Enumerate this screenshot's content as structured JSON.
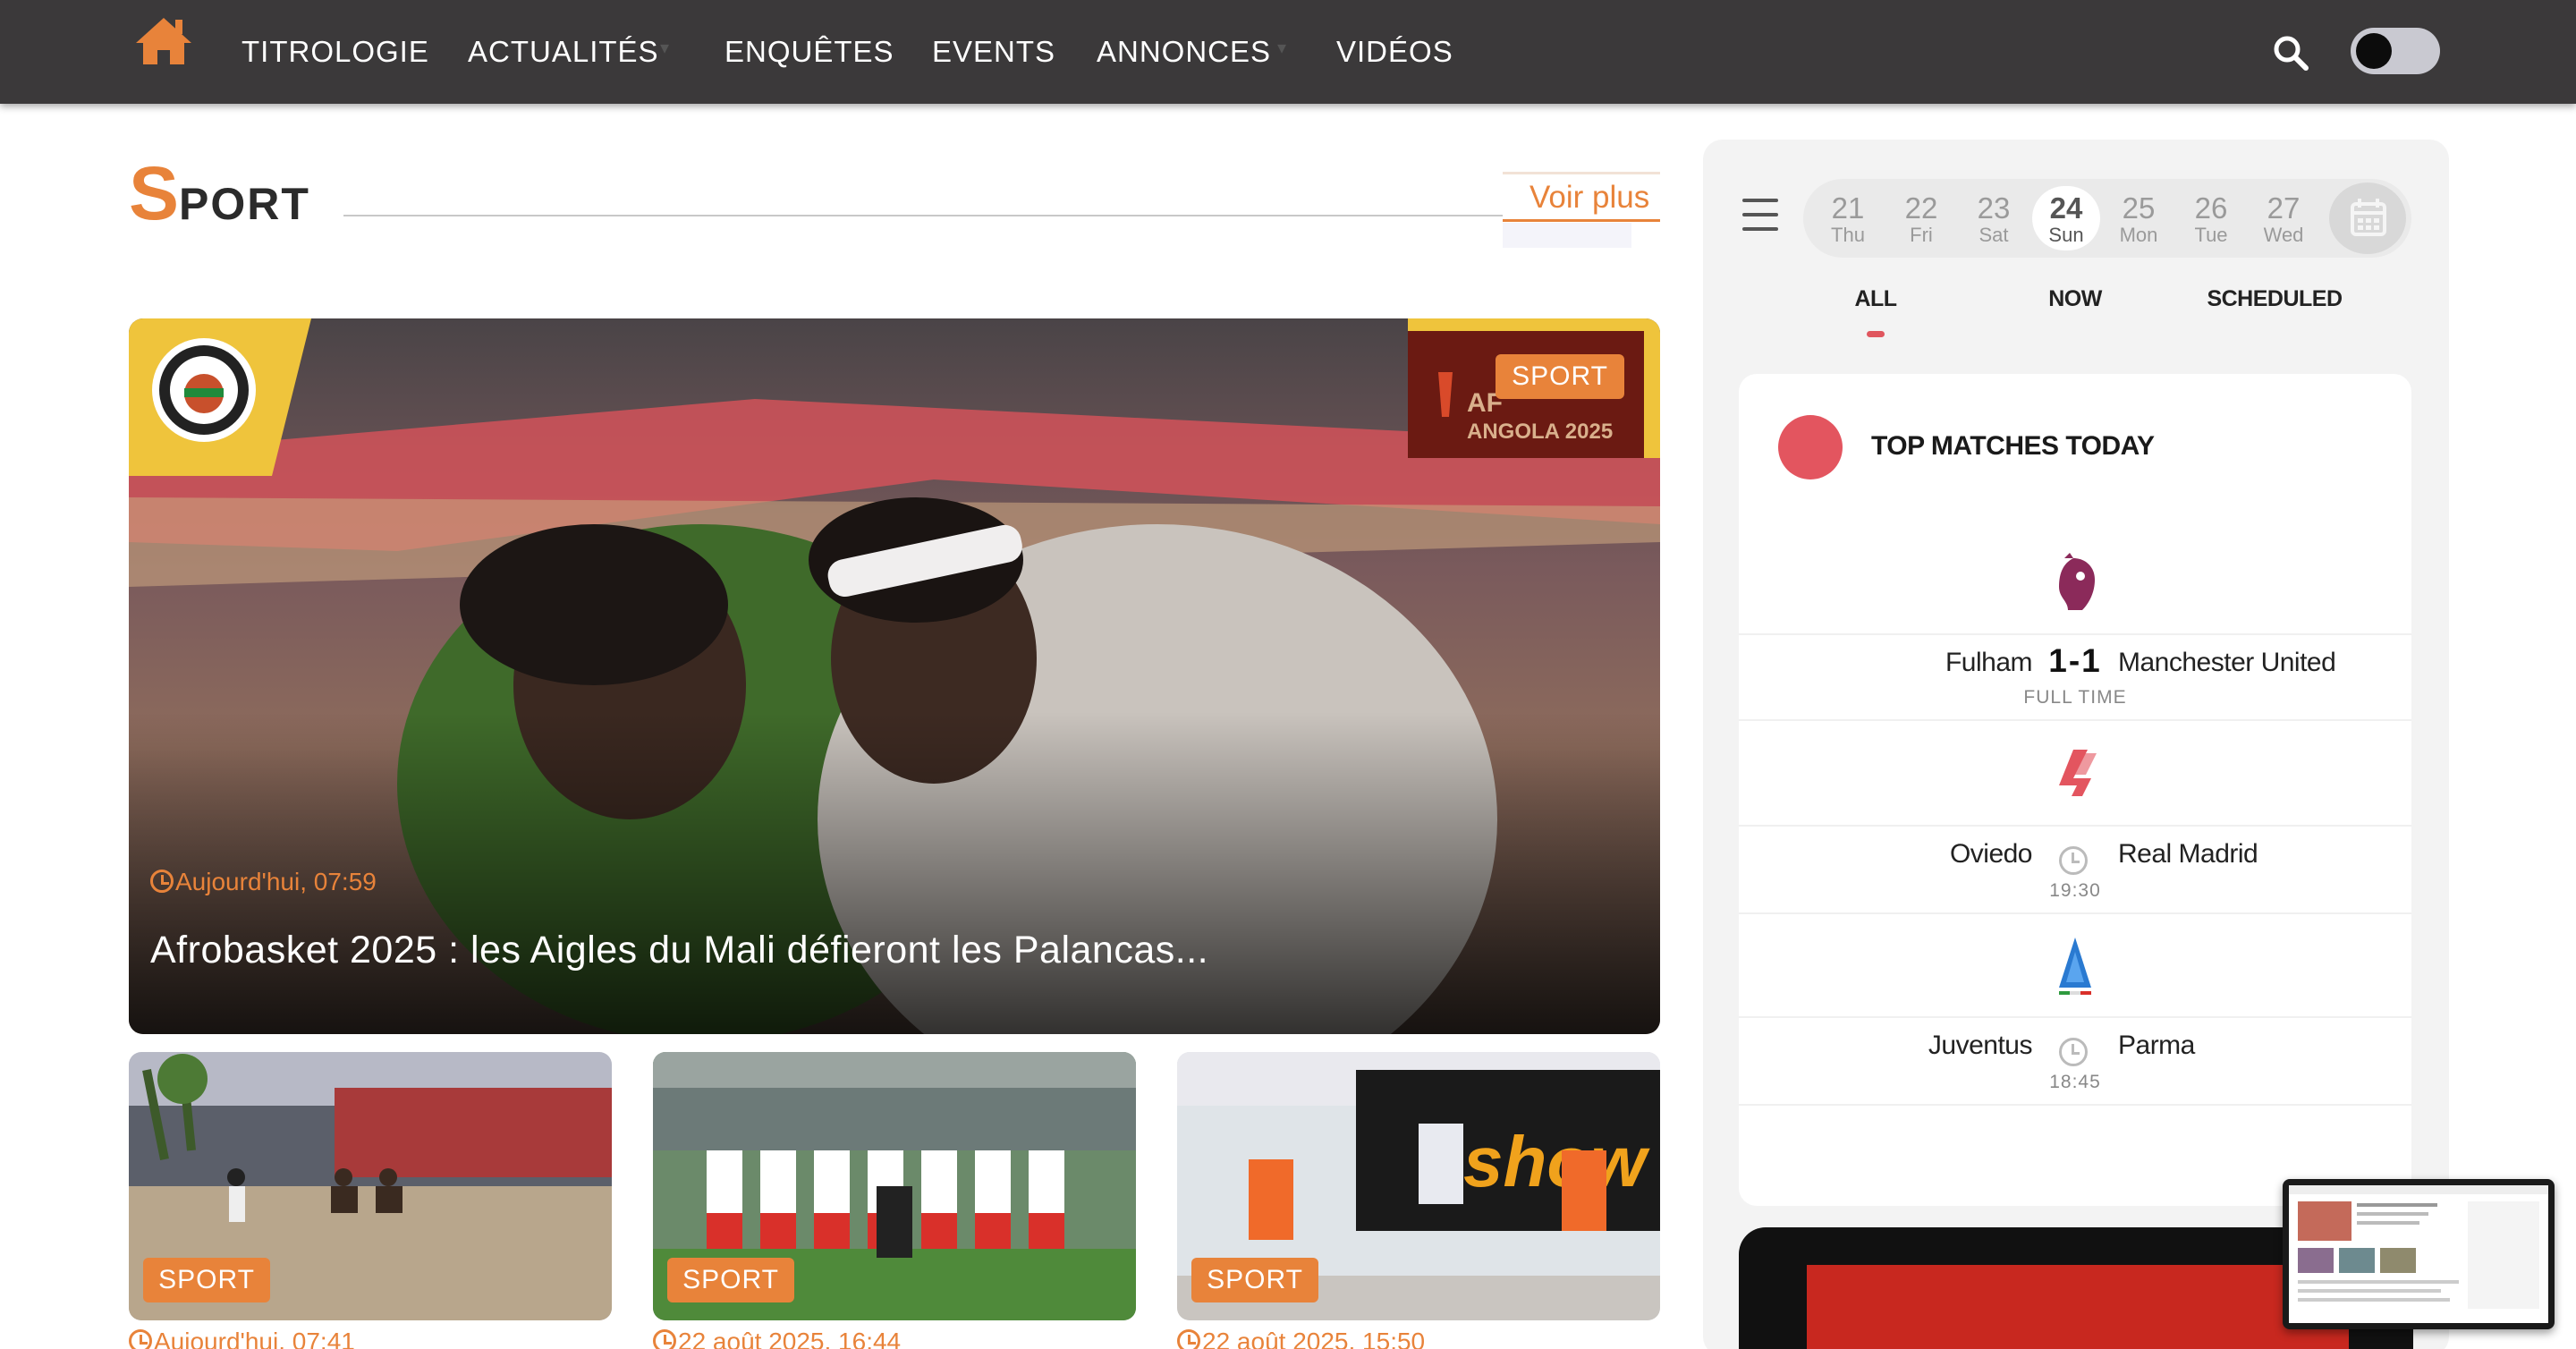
{
  "nav": {
    "items": [
      {
        "label": "TITROLOGIE"
      },
      {
        "label": "ACTUALITÉS"
      },
      {
        "label": "ENQUÊTES"
      },
      {
        "label": "EVENTS"
      },
      {
        "label": "ANNONCES"
      },
      {
        "label": "VIDÉOS"
      }
    ],
    "home_icon": "home-icon",
    "search_icon": "search-icon",
    "theme_toggle": "off"
  },
  "section": {
    "title_first": "S",
    "title_rest": "PORT",
    "voir_plus": "Voir plus"
  },
  "hero": {
    "badge": "SPORT",
    "date": "Aujourd'hui, 07:59",
    "title": "Afrobasket 2025 : les Aigles du Mali défieront les Palancas..."
  },
  "cards": [
    {
      "badge": "SPORT",
      "date": "Aujourd'hui, 07:41"
    },
    {
      "badge": "SPORT",
      "date": "22 août 2025, 16:44"
    },
    {
      "badge": "SPORT",
      "date": "22 août 2025, 15:50"
    }
  ],
  "sidebar": {
    "days": [
      {
        "num": "21",
        "wd": "Thu"
      },
      {
        "num": "22",
        "wd": "Fri"
      },
      {
        "num": "23",
        "wd": "Sat"
      },
      {
        "num": "24",
        "wd": "Sun"
      },
      {
        "num": "25",
        "wd": "Mon"
      },
      {
        "num": "26",
        "wd": "Tue"
      },
      {
        "num": "27",
        "wd": "Wed"
      }
    ],
    "active_day": "24",
    "tabs": [
      {
        "label": "ALL"
      },
      {
        "label": "NOW"
      },
      {
        "label": "SCHEDULED"
      }
    ],
    "active_tab": "ALL",
    "top_title": "TOP MATCHES TODAY",
    "matches": [
      {
        "league_icon": "premier-league-icon",
        "home": "Fulham",
        "away": "Manchester United",
        "score": "1-1",
        "status": "FULL TIME"
      },
      {
        "league_icon": "laliga-icon",
        "home": "Oviedo",
        "away": "Real Madrid",
        "score": "",
        "status": "19:30"
      },
      {
        "league_icon": "serie-a-icon",
        "home": "Juventus",
        "away": "Parma",
        "score": "",
        "status": "18:45"
      }
    ]
  },
  "colors": {
    "accent": "#e8833a",
    "nav_bg": "#3b393a",
    "live_red": "#e3555f"
  }
}
